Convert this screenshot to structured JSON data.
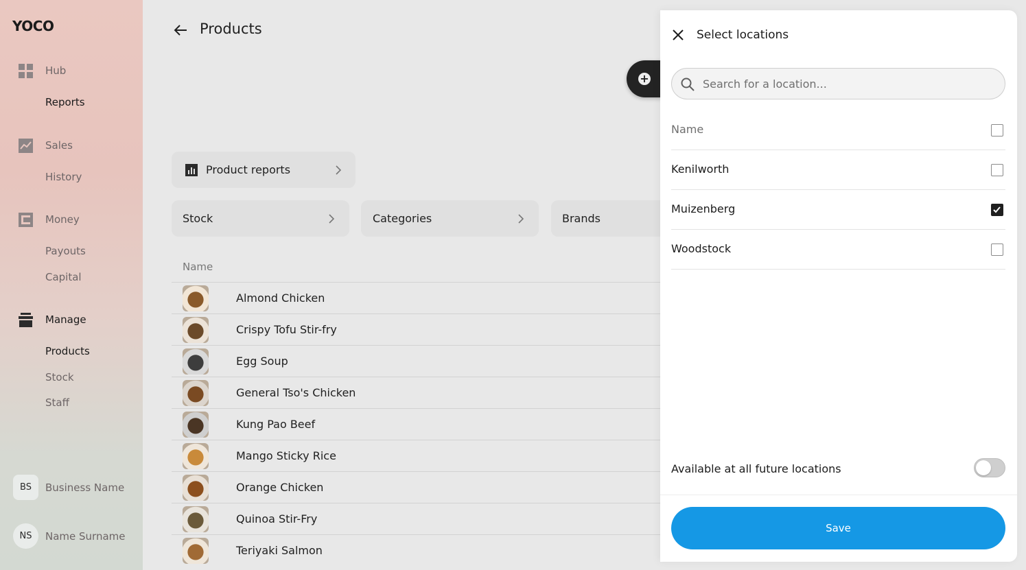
{
  "app": {
    "logo": "YOCO"
  },
  "sidebar": {
    "sections": [
      {
        "icon": "grid-icon",
        "label": "Hub",
        "children": [
          "Reports"
        ]
      },
      {
        "icon": "chart-line-icon",
        "label": "Sales",
        "children": [
          "History"
        ]
      },
      {
        "icon": "wallet-icon",
        "label": "Money",
        "children": [
          "Payouts",
          "Capital"
        ]
      },
      {
        "icon": "store-icon",
        "label": "Manage",
        "children": [
          "Products",
          "Stock",
          "Staff"
        ]
      }
    ],
    "business": {
      "initials": "BS",
      "name": "Business Name"
    },
    "user": {
      "initials": "NS",
      "name": "Name Surname"
    }
  },
  "main": {
    "title": "Products",
    "reports_card": "Product reports",
    "filters": [
      "Stock",
      "Categories",
      "Brands"
    ],
    "table": {
      "column": "Name",
      "rows": [
        "Almond Chicken",
        "Crispy Tofu Stir-fry",
        "Egg Soup",
        "General Tso's Chicken",
        "Kung Pao Beef",
        "Mango Sticky Rice",
        "Orange Chicken",
        "Quinoa Stir-Fry",
        "Teriyaki Salmon"
      ]
    }
  },
  "drawer": {
    "title": "Select locations",
    "search_placeholder": "Search for a location...",
    "header_label": "Name",
    "locations": [
      {
        "name": "Kenilworth",
        "checked": false
      },
      {
        "name": "Muizenberg",
        "checked": true
      },
      {
        "name": "Woodstock",
        "checked": false
      }
    ],
    "future_label": "Available at all future locations",
    "future_enabled": false,
    "save_label": "Save"
  },
  "colors": {
    "accent": "#1598e5",
    "fab": "#232323"
  }
}
